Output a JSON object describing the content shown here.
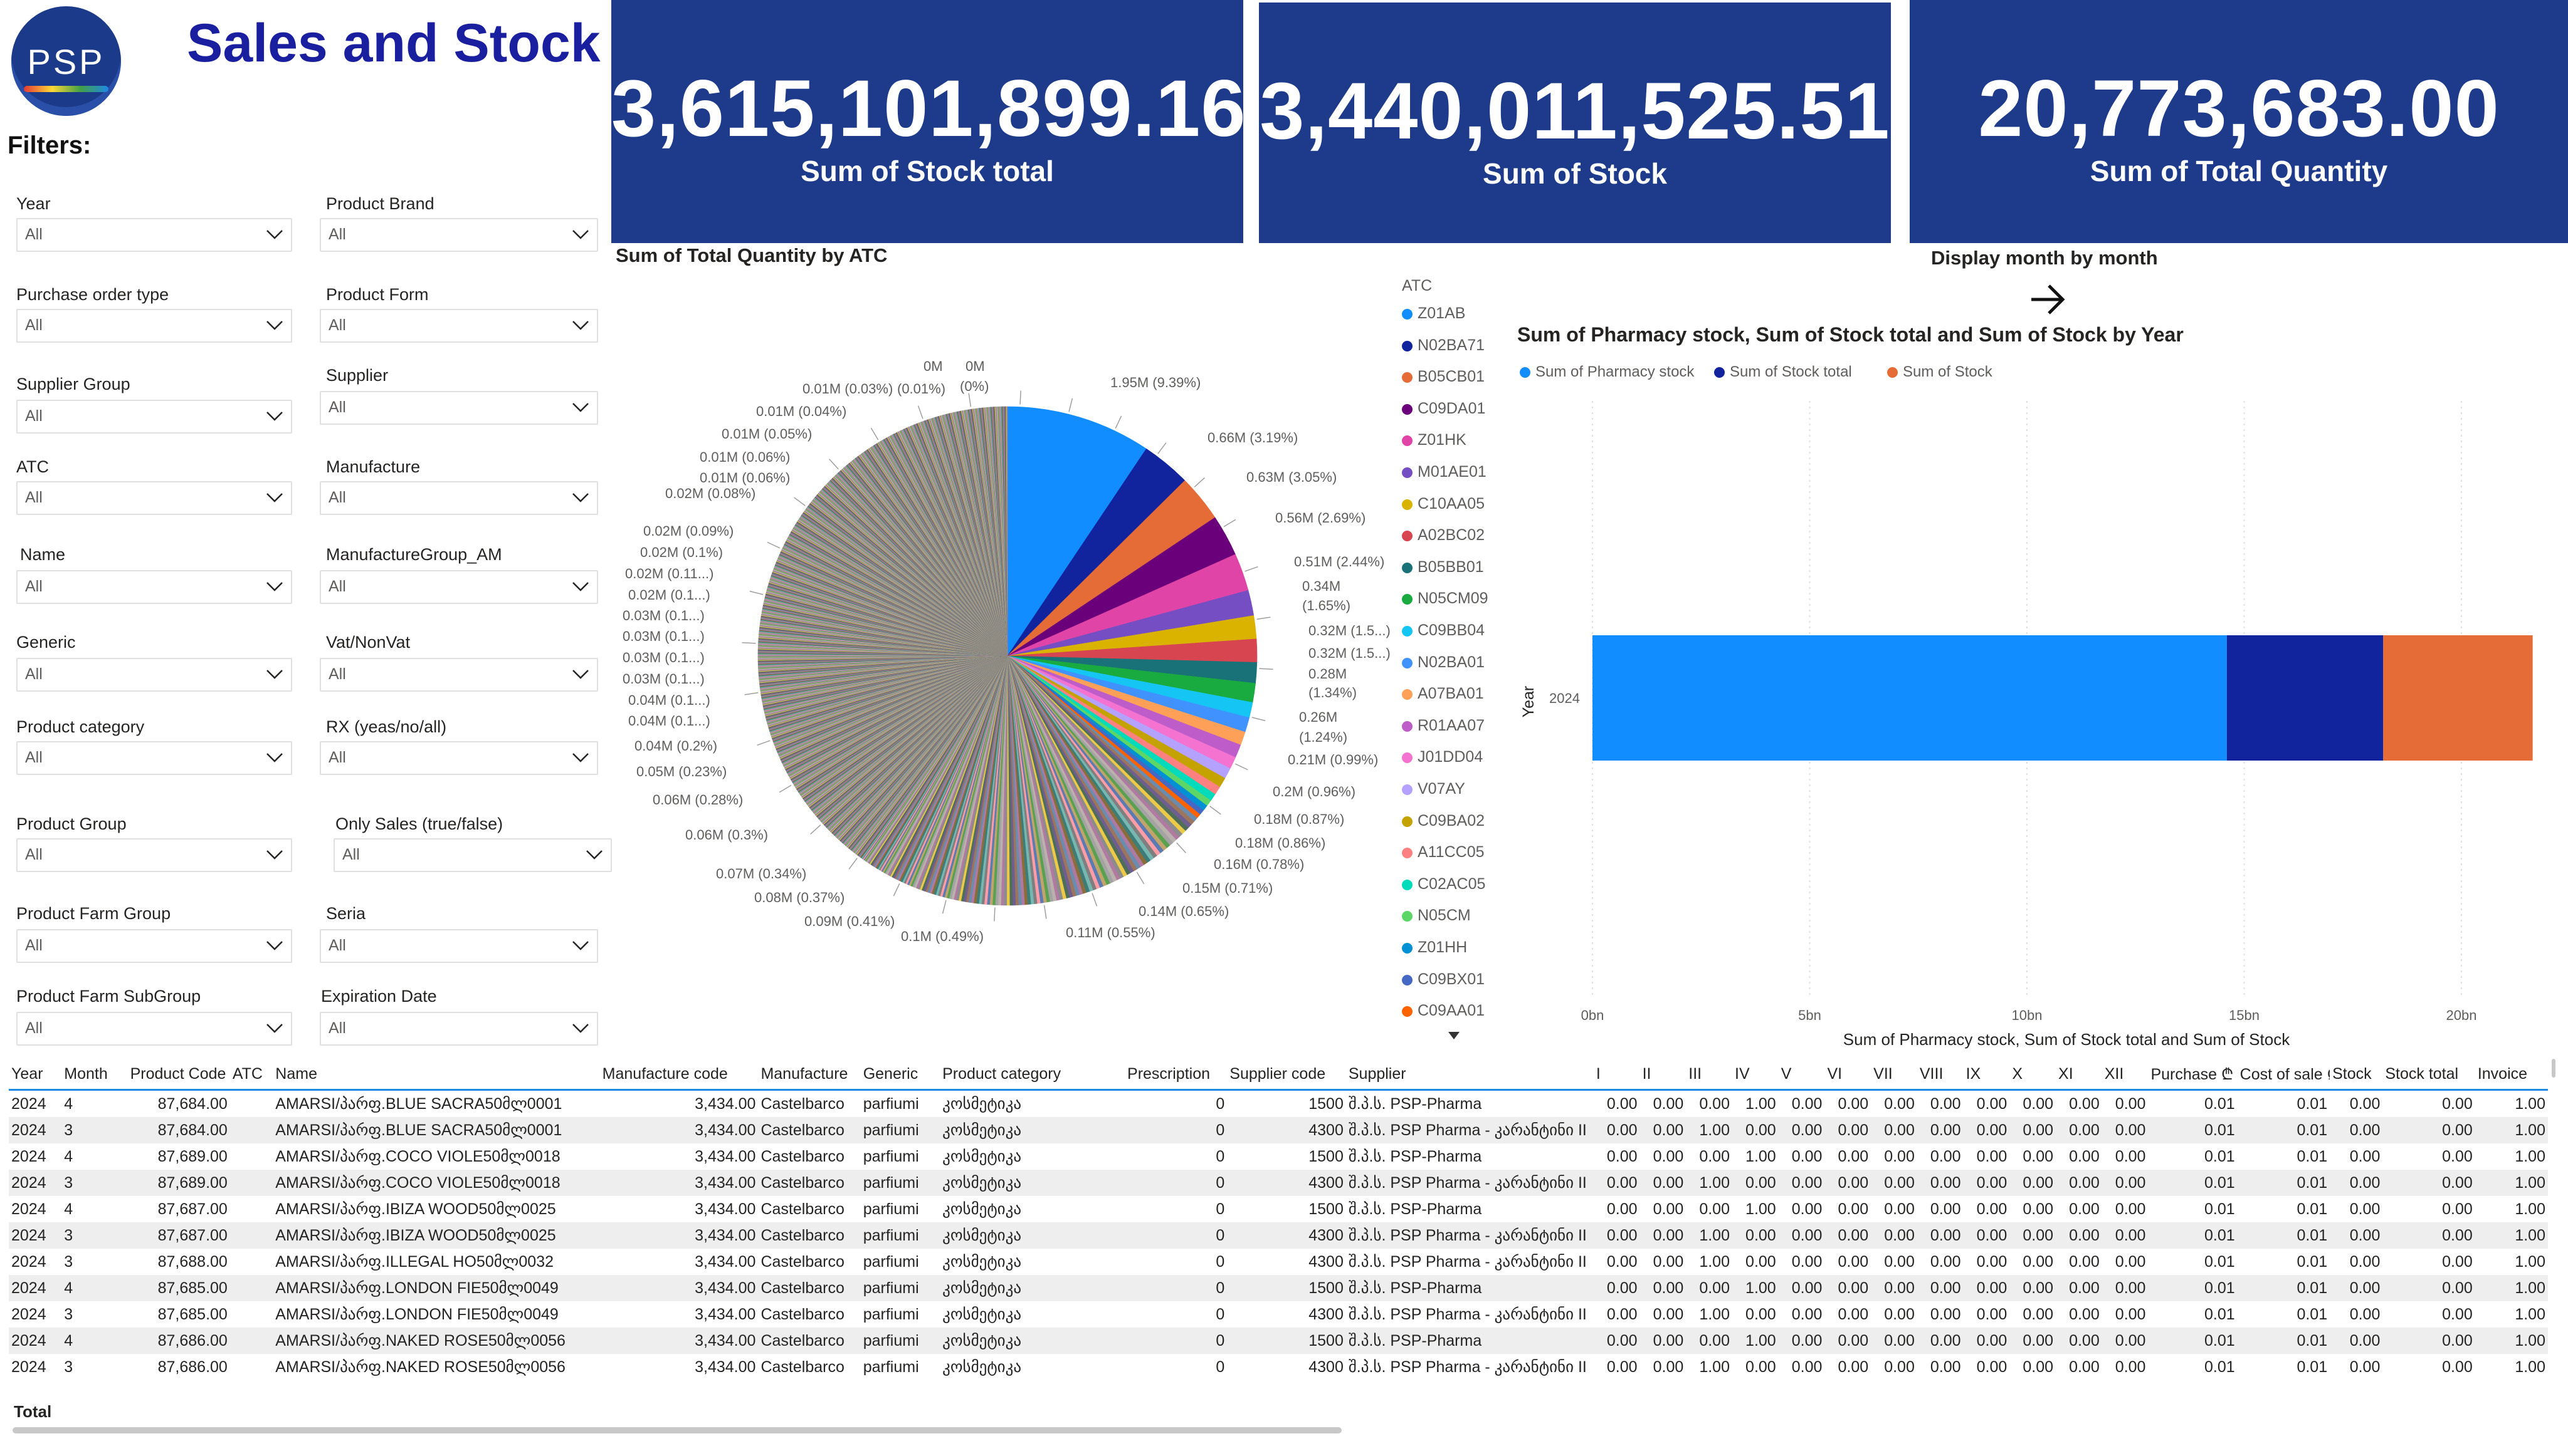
{
  "header": {
    "logo_text": "PSP",
    "title": "Sales and Stock",
    "filters_label": "Filters:"
  },
  "slicers": [
    {
      "label": "Year",
      "value": "All"
    },
    {
      "label": "Product Brand",
      "value": "All"
    },
    {
      "label": "Purchase order type",
      "value": "All"
    },
    {
      "label": "Product Form",
      "value": "All"
    },
    {
      "label": "Supplier Group",
      "value": "All"
    },
    {
      "label": "Supplier",
      "value": "All"
    },
    {
      "label": "ATC",
      "value": "All"
    },
    {
      "label": "Manufacture",
      "value": "All"
    },
    {
      "label": "Name",
      "value": "All"
    },
    {
      "label": "ManufactureGroup_AM",
      "value": "All"
    },
    {
      "label": "Generic",
      "value": "All"
    },
    {
      "label": "Vat/NonVat",
      "value": "All"
    },
    {
      "label": "Product category",
      "value": "All"
    },
    {
      "label": "RX (yeas/no/all)",
      "value": "All"
    },
    {
      "label": "Product Group",
      "value": "All"
    },
    {
      "label": "Only Sales (true/false)",
      "value": "All"
    },
    {
      "label": "Product Farm Group",
      "value": "All"
    },
    {
      "label": "Seria",
      "value": "All"
    },
    {
      "label": "Product Farm SubGroup",
      "value": "All"
    },
    {
      "label": "Expiration Date",
      "value": "All"
    }
  ],
  "kpis": [
    {
      "value": "3,615,101,899.16",
      "label": "Sum of Stock total"
    },
    {
      "value": "3,440,011,525.51",
      "label": "Sum of Stock"
    },
    {
      "value": "20,773,683.00",
      "label": "Sum of Total Quantity"
    }
  ],
  "pie": {
    "title": "Sum of Total Quantity by ATC",
    "legend_title": "ATC",
    "legend": [
      {
        "name": "Z01AB",
        "color": "#118dff"
      },
      {
        "name": "N02BA71",
        "color": "#12239e"
      },
      {
        "name": "B05CB01",
        "color": "#e66c37"
      },
      {
        "name": "C09DA01",
        "color": "#6b007b"
      },
      {
        "name": "Z01HK",
        "color": "#e044a7"
      },
      {
        "name": "M01AE01",
        "color": "#744ec2"
      },
      {
        "name": "C10AA05",
        "color": "#d9b300"
      },
      {
        "name": "A02BC02",
        "color": "#d64550"
      },
      {
        "name": "B05BB01",
        "color": "#197278"
      },
      {
        "name": "N05CM09",
        "color": "#1aab40"
      },
      {
        "name": "C09BB04",
        "color": "#15c6f4"
      },
      {
        "name": "N02BA01",
        "color": "#4092ff"
      },
      {
        "name": "A07BA01",
        "color": "#ffa058"
      },
      {
        "name": "R01AA07",
        "color": "#be5dc9"
      },
      {
        "name": "J01DD04",
        "color": "#f472d0"
      },
      {
        "name": "V07AY",
        "color": "#b5a1ff"
      },
      {
        "name": "C09BA02",
        "color": "#c4a200"
      },
      {
        "name": "A11CC05",
        "color": "#ff8080"
      },
      {
        "name": "C02AC05",
        "color": "#00dbbc"
      },
      {
        "name": "N05CM",
        "color": "#5bd667"
      },
      {
        "name": "Z01HH",
        "color": "#0091d5"
      },
      {
        "name": "C09BX01",
        "color": "#4668c5"
      },
      {
        "name": "C09AA01",
        "color": "#ff6300"
      }
    ],
    "labels": [
      "1.95M (9.39%)",
      "0.66M (3.19%)",
      "0.63M (3.05%)",
      "0.56M (2.69%)",
      "0.51M (2.44%)",
      "0.34M",
      "(1.65%)",
      "0.32M (1.5...)",
      "0.32M (1.5...)",
      "0.28M",
      "(1.34%)",
      "0.26M",
      "(1.24%)",
      "0.21M (0.99%)",
      "0.2M (0.96%)",
      "0.18M (0.87%)",
      "0.18M (0.86%)",
      "0.16M (0.78%)",
      "0.15M (0.71%)",
      "0.14M (0.65%)",
      "0.11M (0.55%)",
      "0.1M (0.49%)",
      "0.09M (0.41%)",
      "0.08M (0.37%)",
      "0.07M (0.34%)",
      "0.06M (0.3%)",
      "0.06M (0.28%)",
      "0.05M (0.23%)",
      "0.04M (0.2%)",
      "0.04M (0.1...)",
      "0.04M (0.1...)",
      "0.03M (0.1...)",
      "0.03M (0.1...)",
      "0.03M (0.1...)",
      "0.03M (0.1...)",
      "0.02M (0.1...)",
      "0.02M (0.11...)",
      "0.02M (0.1%)",
      "0.02M (0.09%)",
      "0.02M (0.08%)",
      "0.01M (0.06%)",
      "0.01M (0.06%)",
      "0.01M (0.05%)",
      "0.01M (0.04%)",
      "0.01M (0.03%)",
      "(0.01%)",
      "0M",
      "0M",
      "(0%)"
    ]
  },
  "display_month": {
    "label": "Display month by month",
    "arrow": "arrow-right-icon"
  },
  "bar": {
    "title": "Sum of Pharmacy stock, Sum of Stock total and Sum of Stock by Year",
    "legend": [
      {
        "name": "Sum of Pharmacy stock",
        "color": "#118dff"
      },
      {
        "name": "Sum of Stock total",
        "color": "#12239e"
      },
      {
        "name": "Sum of Stock",
        "color": "#e66c37"
      }
    ],
    "y_axis_title": "Year",
    "x_axis_title": "Sum of Pharmacy stock, Sum of Stock total and Sum of Stock",
    "x_ticks": [
      "0bn",
      "5bn",
      "10bn",
      "15bn",
      "20bn"
    ]
  },
  "chart_data": {
    "type": "bar",
    "orientation": "horizontal",
    "stacked": true,
    "categories": [
      "2024"
    ],
    "series": [
      {
        "name": "Sum of Pharmacy stock",
        "values": [
          14.6
        ]
      },
      {
        "name": "Sum of Stock total",
        "values": [
          3.6
        ]
      },
      {
        "name": "Sum of Stock",
        "values": [
          3.44
        ]
      }
    ],
    "xlabel": "Sum of Pharmacy stock, Sum of Stock total and Sum of Stock",
    "ylabel": "Year",
    "xlim": [
      0,
      22
    ],
    "unit": "bn",
    "legend_position": "top-left"
  },
  "table": {
    "columns": [
      "Year",
      "Month",
      "Product Code",
      "ATC",
      "Name",
      "Manufacture code",
      "Manufacture",
      "Generic",
      "Product category",
      "Prescription",
      "Supplier code",
      "Supplier",
      "I",
      "II",
      "III",
      "IV",
      "V",
      "VI",
      "VII",
      "VIII",
      "IX",
      "X",
      "XI",
      "XII",
      "Purchase ₾",
      "Cost of sale ₾",
      "Stock",
      "Stock total",
      "Invoice"
    ],
    "rows": [
      [
        "2024",
        "4",
        "87,684.00",
        "",
        "AMARSI/პარფ.BLUE SACRA50მლ0001",
        "3,434.00",
        "Castelbarco",
        "parfiumi",
        "კოსმეტიკა",
        "0",
        "1500",
        "შ.პ.ს. PSP-Pharma",
        "0.00",
        "0.00",
        "0.00",
        "1.00",
        "0.00",
        "0.00",
        "0.00",
        "0.00",
        "0.00",
        "0.00",
        "0.00",
        "0.00",
        "0.01",
        "0.01",
        "0.00",
        "0.00",
        "1.00"
      ],
      [
        "2024",
        "3",
        "87,684.00",
        "",
        "AMARSI/პარფ.BLUE SACRA50მლ0001",
        "3,434.00",
        "Castelbarco",
        "parfiumi",
        "კოსმეტიკა",
        "0",
        "4300",
        "შ.პ.ს. PSP Pharma - კარანტინი II",
        "0.00",
        "0.00",
        "1.00",
        "0.00",
        "0.00",
        "0.00",
        "0.00",
        "0.00",
        "0.00",
        "0.00",
        "0.00",
        "0.00",
        "0.01",
        "0.01",
        "0.00",
        "0.00",
        "1.00"
      ],
      [
        "2024",
        "4",
        "87,689.00",
        "",
        "AMARSI/პარფ.COCO VIOLE50მლ0018",
        "3,434.00",
        "Castelbarco",
        "parfiumi",
        "კოსმეტიკა",
        "0",
        "1500",
        "შ.პ.ს. PSP-Pharma",
        "0.00",
        "0.00",
        "0.00",
        "1.00",
        "0.00",
        "0.00",
        "0.00",
        "0.00",
        "0.00",
        "0.00",
        "0.00",
        "0.00",
        "0.01",
        "0.01",
        "0.00",
        "0.00",
        "1.00"
      ],
      [
        "2024",
        "3",
        "87,689.00",
        "",
        "AMARSI/პარფ.COCO VIOLE50მლ0018",
        "3,434.00",
        "Castelbarco",
        "parfiumi",
        "კოსმეტიკა",
        "0",
        "4300",
        "შ.პ.ს. PSP Pharma - კარანტინი II",
        "0.00",
        "0.00",
        "1.00",
        "0.00",
        "0.00",
        "0.00",
        "0.00",
        "0.00",
        "0.00",
        "0.00",
        "0.00",
        "0.00",
        "0.01",
        "0.01",
        "0.00",
        "0.00",
        "1.00"
      ],
      [
        "2024",
        "4",
        "87,687.00",
        "",
        "AMARSI/პარფ.IBIZA WOOD50მლ0025",
        "3,434.00",
        "Castelbarco",
        "parfiumi",
        "კოსმეტიკა",
        "0",
        "1500",
        "შ.პ.ს. PSP-Pharma",
        "0.00",
        "0.00",
        "0.00",
        "1.00",
        "0.00",
        "0.00",
        "0.00",
        "0.00",
        "0.00",
        "0.00",
        "0.00",
        "0.00",
        "0.01",
        "0.01",
        "0.00",
        "0.00",
        "1.00"
      ],
      [
        "2024",
        "3",
        "87,687.00",
        "",
        "AMARSI/პარფ.IBIZA WOOD50მლ0025",
        "3,434.00",
        "Castelbarco",
        "parfiumi",
        "კოსმეტიკა",
        "0",
        "4300",
        "შ.პ.ს. PSP Pharma - კარანტინი II",
        "0.00",
        "0.00",
        "1.00",
        "0.00",
        "0.00",
        "0.00",
        "0.00",
        "0.00",
        "0.00",
        "0.00",
        "0.00",
        "0.00",
        "0.01",
        "0.01",
        "0.00",
        "0.00",
        "1.00"
      ],
      [
        "2024",
        "3",
        "87,688.00",
        "",
        "AMARSI/პარფ.ILLEGAL HO50მლ0032",
        "3,434.00",
        "Castelbarco",
        "parfiumi",
        "კოსმეტიკა",
        "0",
        "4300",
        "შ.პ.ს. PSP Pharma - კარანტინი II",
        "0.00",
        "0.00",
        "1.00",
        "0.00",
        "0.00",
        "0.00",
        "0.00",
        "0.00",
        "0.00",
        "0.00",
        "0.00",
        "0.00",
        "0.01",
        "0.01",
        "0.00",
        "0.00",
        "1.00"
      ],
      [
        "2024",
        "4",
        "87,685.00",
        "",
        "AMARSI/პარფ.LONDON FIE50მლ0049",
        "3,434.00",
        "Castelbarco",
        "parfiumi",
        "კოსმეტიკა",
        "0",
        "1500",
        "შ.პ.ს. PSP-Pharma",
        "0.00",
        "0.00",
        "0.00",
        "1.00",
        "0.00",
        "0.00",
        "0.00",
        "0.00",
        "0.00",
        "0.00",
        "0.00",
        "0.00",
        "0.01",
        "0.01",
        "0.00",
        "0.00",
        "1.00"
      ],
      [
        "2024",
        "3",
        "87,685.00",
        "",
        "AMARSI/პარფ.LONDON FIE50მლ0049",
        "3,434.00",
        "Castelbarco",
        "parfiumi",
        "კოსმეტიკა",
        "0",
        "4300",
        "შ.პ.ს. PSP Pharma - კარანტინი II",
        "0.00",
        "0.00",
        "1.00",
        "0.00",
        "0.00",
        "0.00",
        "0.00",
        "0.00",
        "0.00",
        "0.00",
        "0.00",
        "0.00",
        "0.01",
        "0.01",
        "0.00",
        "0.00",
        "1.00"
      ],
      [
        "2024",
        "4",
        "87,686.00",
        "",
        "AMARSI/პარფ.NAKED ROSE50მლ0056",
        "3,434.00",
        "Castelbarco",
        "parfiumi",
        "კოსმეტიკა",
        "0",
        "1500",
        "შ.პ.ს. PSP-Pharma",
        "0.00",
        "0.00",
        "0.00",
        "1.00",
        "0.00",
        "0.00",
        "0.00",
        "0.00",
        "0.00",
        "0.00",
        "0.00",
        "0.00",
        "0.01",
        "0.01",
        "0.00",
        "0.00",
        "1.00"
      ],
      [
        "2024",
        "3",
        "87,686.00",
        "",
        "AMARSI/პარფ.NAKED ROSE50მლ0056",
        "3,434.00",
        "Castelbarco",
        "parfiumi",
        "კოსმეტიკა",
        "0",
        "4300",
        "შ.პ.ს. PSP Pharma - კარანტინი II",
        "0.00",
        "0.00",
        "1.00",
        "0.00",
        "0.00",
        "0.00",
        "0.00",
        "0.00",
        "0.00",
        "0.00",
        "0.00",
        "0.00",
        "0.01",
        "0.01",
        "0.00",
        "0.00",
        "1.00"
      ]
    ],
    "total_label": "Total"
  }
}
